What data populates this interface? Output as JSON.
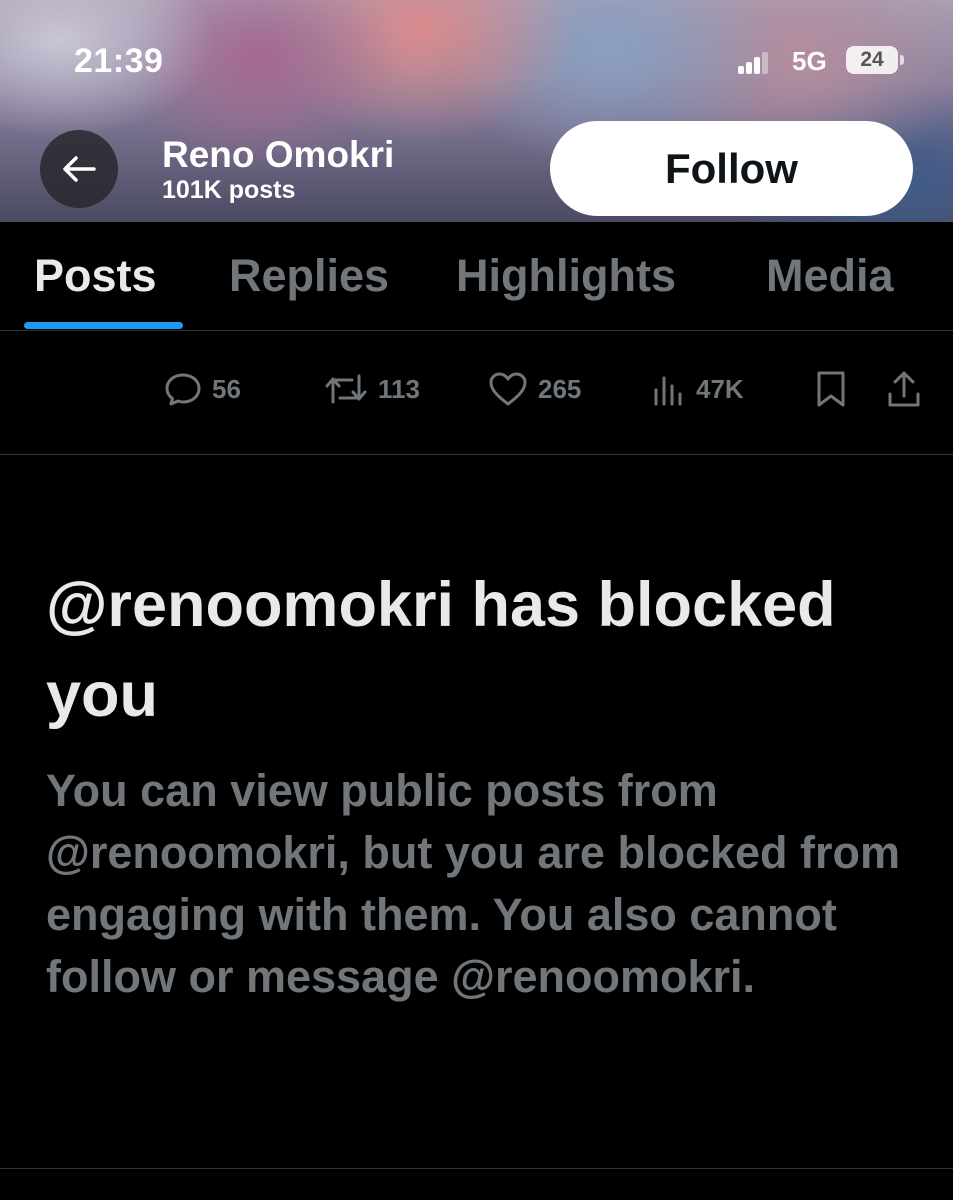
{
  "status_bar": {
    "time": "21:39",
    "network": "5G",
    "battery": "24"
  },
  "header": {
    "name": "Reno Omokri",
    "post_count": "101K posts",
    "follow_label": "Follow"
  },
  "tabs": [
    {
      "label": "Posts",
      "active": true
    },
    {
      "label": "Replies",
      "active": false
    },
    {
      "label": "Highlights",
      "active": false
    },
    {
      "label": "Media",
      "active": false
    }
  ],
  "post_actions": {
    "replies": "56",
    "reposts": "113",
    "likes": "265",
    "views": "47K",
    "icons": [
      "reply-icon",
      "repost-icon",
      "like-icon",
      "views-icon",
      "bookmark-icon",
      "share-icon"
    ]
  },
  "blocked_notice": {
    "title": "@renoomokri has blocked you",
    "body": "You can view public posts from @renoomokri, but you are blocked from engaging with them. You also cannot follow or message @renoomokri."
  },
  "colors": {
    "accent": "#1d9bf0",
    "background": "#000000",
    "primary_text": "#e7e9ea",
    "secondary_text": "#71767b"
  }
}
